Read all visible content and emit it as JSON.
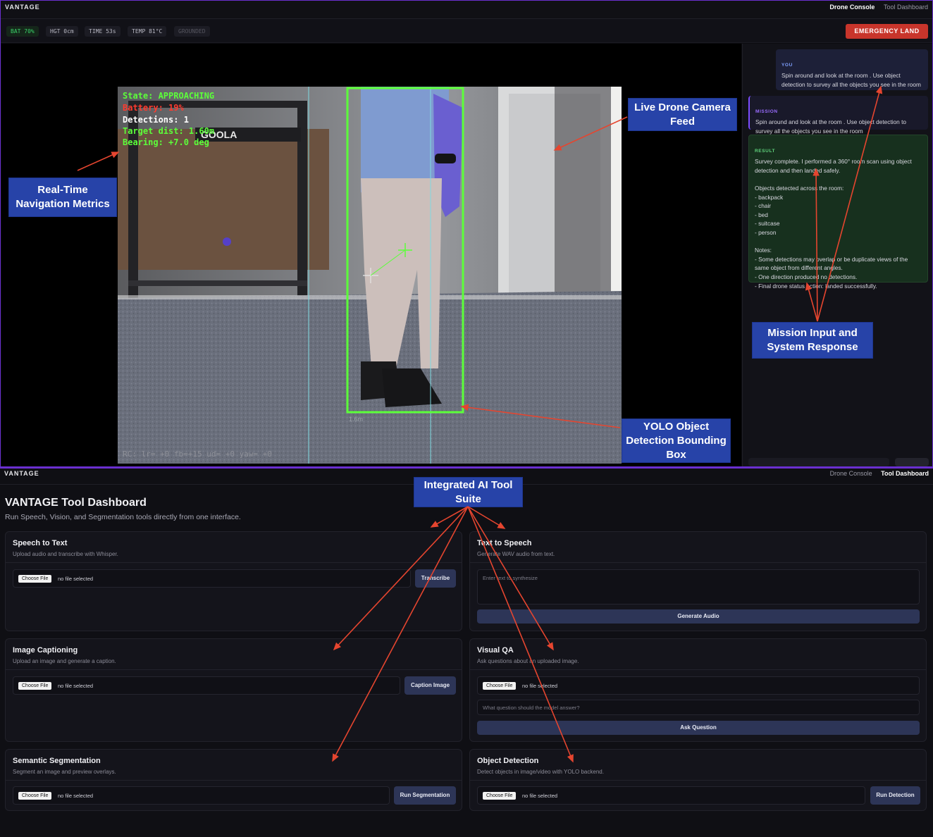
{
  "console": {
    "brand": "VANTAGE",
    "nav": [
      "Drone Console",
      "Tool Dashboard"
    ],
    "status": {
      "battery": "BAT 70%",
      "height": "HGT 0cm",
      "time": "TIME 53s",
      "temp": "TEMP 81°C",
      "state": "GROUNDED"
    },
    "emergency_label": "EMERGENCY LAND",
    "hud": {
      "state": "State: APPROACHING",
      "battery": "Battery: 19%",
      "detections": "Detections: 1",
      "target": "Target dist: 1.60m",
      "bearing": "Bearing: +7.0 deg",
      "rc": "RC: lr= +0 fb=+15 ud= +0 yaw= +0",
      "box_label": "1.6m",
      "banner_text": "GOOLA"
    },
    "chat": {
      "you_tag": "YOU",
      "you_text": "Spin around and look at the room . Use object detection to survey all the objects you see in the room",
      "mission_tag": "MISSION",
      "mission_text": "Spin around and look at the room . Use object detection to survey all the objects you see in the room",
      "result_tag": "RESULT",
      "result_text": "Survey complete. I performed a 360° room scan using object detection and then landed safely.\n\nObjects detected across the room:\n- backpack\n- chair\n- bed\n- suitcase\n- person\n\nNotes:\n- Some detections may overlap or be duplicate views of the same object from different angles.\n- One direction produced no detections.\n- Final drone status action: landed successfully."
    }
  },
  "callouts": {
    "nav_metrics": "Real-Time Navigation Metrics",
    "camera_feed": "Live Drone Camera Feed",
    "mission": "Mission Input and System Response",
    "yolo": "YOLO Object Detection Bounding Box",
    "tool_suite": "Integrated AI Tool Suite"
  },
  "dashboard": {
    "brand": "VANTAGE",
    "nav": [
      "Drone Console",
      "Tool Dashboard"
    ],
    "title": "VANTAGE Tool Dashboard",
    "subtitle": "Run Speech, Vision, and Segmentation tools directly from one interface.",
    "choose_file": "Choose File",
    "no_file": "no file selected",
    "cards": {
      "stt": {
        "title": "Speech to Text",
        "desc": "Upload audio and transcribe with Whisper.",
        "button": "Transcribe"
      },
      "tts": {
        "title": "Text to Speech",
        "desc": "Generate WAV audio from text.",
        "placeholder": "Enter text to synthesize",
        "button": "Generate Audio"
      },
      "caption": {
        "title": "Image Captioning",
        "desc": "Upload an image and generate a caption.",
        "button": "Caption Image"
      },
      "vqa": {
        "title": "Visual QA",
        "desc": "Ask questions about an uploaded image.",
        "placeholder": "What question should the model answer?",
        "button": "Ask Question"
      },
      "seg": {
        "title": "Semantic Segmentation",
        "desc": "Segment an image and preview overlays.",
        "button": "Run Segmentation"
      },
      "det": {
        "title": "Object Detection",
        "desc": "Detect objects in image/video with YOLO backend.",
        "button": "Run Detection"
      }
    }
  }
}
